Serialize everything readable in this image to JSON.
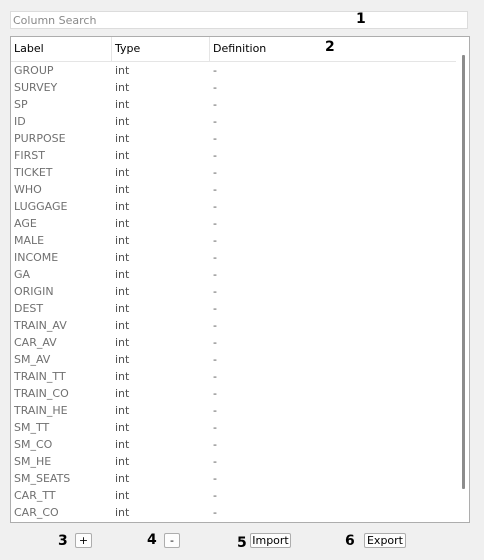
{
  "search": {
    "placeholder": "Column Search",
    "value": ""
  },
  "markers": {
    "m1": "1",
    "m2": "2",
    "m3": "3",
    "m4": "4",
    "m5": "5",
    "m6": "6"
  },
  "table": {
    "headers": {
      "label": "Label",
      "type": "Type",
      "definition": "Definition"
    },
    "rows": [
      {
        "label": "GROUP",
        "type": "int",
        "definition": "-"
      },
      {
        "label": "SURVEY",
        "type": "int",
        "definition": "-"
      },
      {
        "label": "SP",
        "type": "int",
        "definition": "-"
      },
      {
        "label": "ID",
        "type": "int",
        "definition": "-"
      },
      {
        "label": "PURPOSE",
        "type": "int",
        "definition": "-"
      },
      {
        "label": "FIRST",
        "type": "int",
        "definition": "-"
      },
      {
        "label": "TICKET",
        "type": "int",
        "definition": "-"
      },
      {
        "label": "WHO",
        "type": "int",
        "definition": "-"
      },
      {
        "label": "LUGGAGE",
        "type": "int",
        "definition": "-"
      },
      {
        "label": "AGE",
        "type": "int",
        "definition": "-"
      },
      {
        "label": "MALE",
        "type": "int",
        "definition": "-"
      },
      {
        "label": "INCOME",
        "type": "int",
        "definition": "-"
      },
      {
        "label": "GA",
        "type": "int",
        "definition": "-"
      },
      {
        "label": "ORIGIN",
        "type": "int",
        "definition": "-"
      },
      {
        "label": "DEST",
        "type": "int",
        "definition": "-"
      },
      {
        "label": "TRAIN_AV",
        "type": "int",
        "definition": "-"
      },
      {
        "label": "CAR_AV",
        "type": "int",
        "definition": "-"
      },
      {
        "label": "SM_AV",
        "type": "int",
        "definition": "-"
      },
      {
        "label": "TRAIN_TT",
        "type": "int",
        "definition": "-"
      },
      {
        "label": "TRAIN_CO",
        "type": "int",
        "definition": "-"
      },
      {
        "label": "TRAIN_HE",
        "type": "int",
        "definition": "-"
      },
      {
        "label": "SM_TT",
        "type": "int",
        "definition": "-"
      },
      {
        "label": "SM_CO",
        "type": "int",
        "definition": "-"
      },
      {
        "label": "SM_HE",
        "type": "int",
        "definition": "-"
      },
      {
        "label": "SM_SEATS",
        "type": "int",
        "definition": "-"
      },
      {
        "label": "CAR_TT",
        "type": "int",
        "definition": "-"
      },
      {
        "label": "CAR_CO",
        "type": "int",
        "definition": "-"
      }
    ]
  },
  "buttons": {
    "add": "+",
    "remove": "-",
    "import": "Import",
    "export": "Export"
  }
}
